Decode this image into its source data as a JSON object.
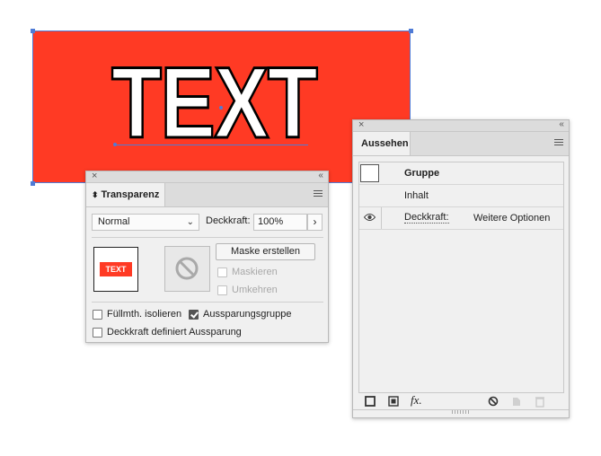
{
  "canvas": {
    "artwork_text": "TEXT",
    "artwork_color": "#ff3a24",
    "selection_color": "#4f7bd6"
  },
  "transparency_panel": {
    "tab_label": "Transparenz",
    "close_label": "×",
    "collapse_label": "‹‹",
    "blend_mode": "Normal",
    "opacity_label": "Deckkraft:",
    "opacity_value": "100%",
    "opacity_arrow": "›",
    "thumbnail_text": "TEXT",
    "make_mask_button": "Maske erstellen",
    "clip_label": "Maskieren",
    "invert_label": "Umkehren",
    "isolate_label": "Füllmth. isolieren",
    "knockout_label": "Aussparungsgruppe",
    "opacity_knockout_label": "Deckkraft definiert Aussparung",
    "knockout_checked": true
  },
  "appearance_panel": {
    "tab_label": "Aussehen",
    "close_label": "×",
    "collapse_label": "‹‹",
    "rows": [
      {
        "label": "Gruppe"
      },
      {
        "label": "Inhalt"
      },
      {
        "label": "Deckkraft:",
        "value": "Weitere Optionen"
      }
    ],
    "footer_icons": [
      "new-stroke-icon",
      "new-fill-icon",
      "fx-icon",
      "clear-appearance-icon",
      "duplicate-item-icon",
      "delete-item-icon"
    ],
    "fx_label": "fx."
  }
}
